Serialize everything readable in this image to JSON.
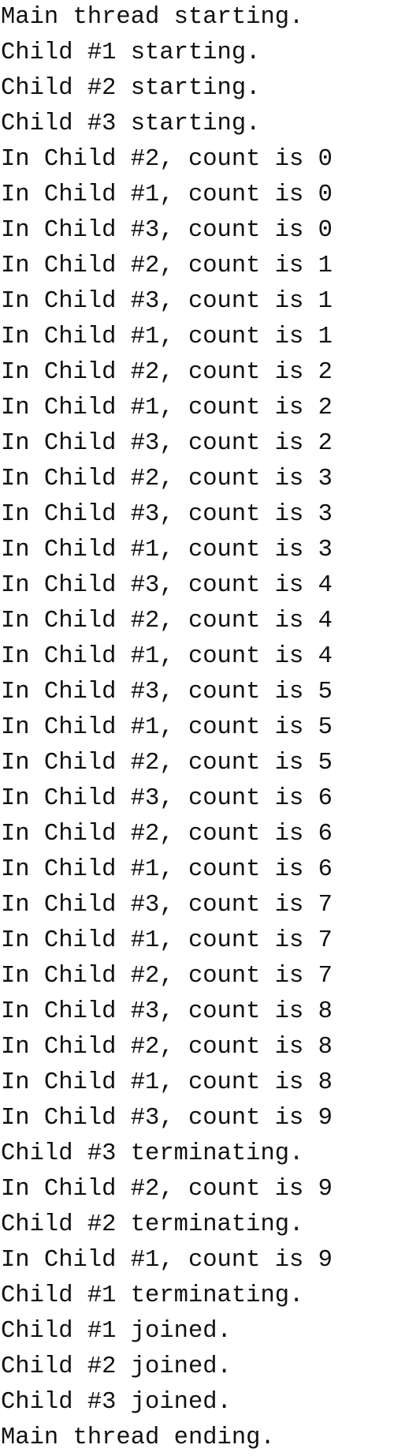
{
  "output": {
    "lines": [
      "Main thread starting.",
      "Child #1 starting.",
      "Child #2 starting.",
      "Child #3 starting.",
      "In Child #2, count is 0",
      "In Child #1, count is 0",
      "In Child #3, count is 0",
      "In Child #2, count is 1",
      "In Child #3, count is 1",
      "In Child #1, count is 1",
      "In Child #2, count is 2",
      "In Child #1, count is 2",
      "In Child #3, count is 2",
      "In Child #2, count is 3",
      "In Child #3, count is 3",
      "In Child #1, count is 3",
      "In Child #3, count is 4",
      "In Child #2, count is 4",
      "In Child #1, count is 4",
      "In Child #3, count is 5",
      "In Child #1, count is 5",
      "In Child #2, count is 5",
      "In Child #3, count is 6",
      "In Child #2, count is 6",
      "In Child #1, count is 6",
      "In Child #3, count is 7",
      "In Child #1, count is 7",
      "In Child #2, count is 7",
      "In Child #3, count is 8",
      "In Child #2, count is 8",
      "In Child #1, count is 8",
      "In Child #3, count is 9",
      "Child #3 terminating.",
      "In Child #2, count is 9",
      "Child #2 terminating.",
      "In Child #1, count is 9",
      "Child #1 terminating.",
      "Child #1 joined.",
      "Child #2 joined.",
      "Child #3 joined.",
      "Main thread ending."
    ]
  }
}
